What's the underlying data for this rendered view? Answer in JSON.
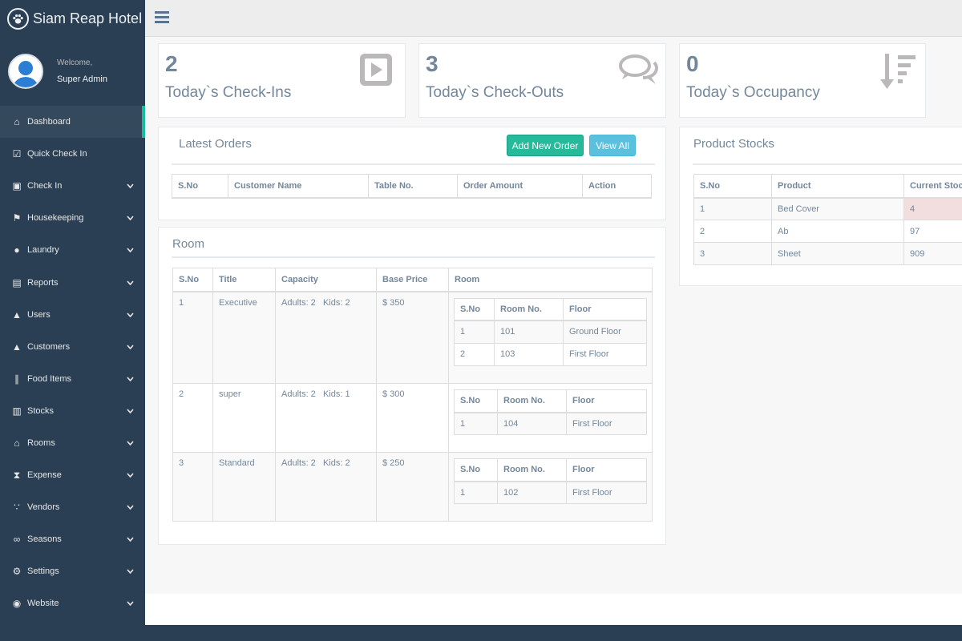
{
  "brand": {
    "title": "Siam Reap Hotel",
    "logo_icon": "paw-icon"
  },
  "profile": {
    "welcome": "Welcome,",
    "name": "Super Admin"
  },
  "sidebar": {
    "items": [
      {
        "label": "Dashboard",
        "icon": "home-icon",
        "active": true,
        "has_chevron": false
      },
      {
        "label": "Quick Check In",
        "icon": "check-square-icon",
        "has_chevron": false
      },
      {
        "label": "Check In",
        "icon": "money-icon",
        "has_chevron": true
      },
      {
        "label": "Housekeeping",
        "icon": "flag-icon",
        "has_chevron": true
      },
      {
        "label": "Laundry",
        "icon": "tint-icon",
        "has_chevron": true
      },
      {
        "label": "Reports",
        "icon": "file-icon",
        "has_chevron": true
      },
      {
        "label": "Users",
        "icon": "user-icon",
        "has_chevron": true
      },
      {
        "label": "Customers",
        "icon": "user-icon",
        "has_chevron": true
      },
      {
        "label": "Food Items",
        "icon": "cutlery-icon",
        "has_chevron": true
      },
      {
        "label": "Stocks",
        "icon": "cart-icon",
        "has_chevron": true
      },
      {
        "label": "Rooms",
        "icon": "home-icon",
        "has_chevron": true
      },
      {
        "label": "Expense",
        "icon": "hourglass-icon",
        "has_chevron": true
      },
      {
        "label": "Vendors",
        "icon": "handshake-icon",
        "has_chevron": true
      },
      {
        "label": "Seasons",
        "icon": "infinity-icon",
        "has_chevron": true
      },
      {
        "label": "Settings",
        "icon": "gear-icon",
        "has_chevron": true
      },
      {
        "label": "Website",
        "icon": "globe-icon",
        "has_chevron": true
      }
    ]
  },
  "tiles": [
    {
      "count": "2",
      "label": "Today`s Check-Ins",
      "icon": "play-square-icon"
    },
    {
      "count": "3",
      "label": "Today`s Check-Outs",
      "icon": "comments-icon"
    },
    {
      "count": "0",
      "label": "Today`s Occupancy",
      "icon": "sort-amount-desc-icon"
    }
  ],
  "orders": {
    "title": "Latest Orders",
    "add_button": "Add New Order",
    "view_button": "View All",
    "columns": [
      "S.No",
      "Customer Name",
      "Table No.",
      "Order Amount",
      "Action"
    ]
  },
  "rooms": {
    "title": "Room",
    "columns": [
      "S.No",
      "Title",
      "Capacity",
      "Base Price",
      "Room"
    ],
    "inner_columns": [
      "S.No",
      "Room No.",
      "Floor"
    ],
    "rows": [
      {
        "sno": "1",
        "title": "Executive",
        "capacity": "Adults: 2   Kids: 2",
        "price": "$ 350",
        "rooms": [
          {
            "sno": "1",
            "no": "101",
            "floor": "Ground Floor"
          },
          {
            "sno": "2",
            "no": "103",
            "floor": "First Floor"
          }
        ]
      },
      {
        "sno": "2",
        "title": "super",
        "capacity": "Adults: 2   Kids: 1",
        "price": "$ 300",
        "rooms": [
          {
            "sno": "1",
            "no": "104",
            "floor": "First Floor"
          }
        ]
      },
      {
        "sno": "3",
        "title": "Standard",
        "capacity": "Adults: 2   Kids: 2",
        "price": "$ 250",
        "rooms": [
          {
            "sno": "1",
            "no": "102",
            "floor": "First Floor"
          }
        ]
      }
    ]
  },
  "stocks": {
    "title": "Product Stocks",
    "columns": [
      "S.No",
      "Product",
      "Current Stock"
    ],
    "rows": [
      {
        "sno": "1",
        "product": "Bed Cover",
        "stock": "4",
        "low": true
      },
      {
        "sno": "2",
        "product": "Ab",
        "stock": "97",
        "low": false
      },
      {
        "sno": "3",
        "product": "Sheet",
        "stock": "909",
        "low": false
      }
    ]
  },
  "colors": {
    "sidebar": "#2a3f54",
    "accent": "#1abb9c",
    "btn_green": "#26b99a",
    "btn_blue": "#5bc0de",
    "low_stock": "#f2dede"
  }
}
